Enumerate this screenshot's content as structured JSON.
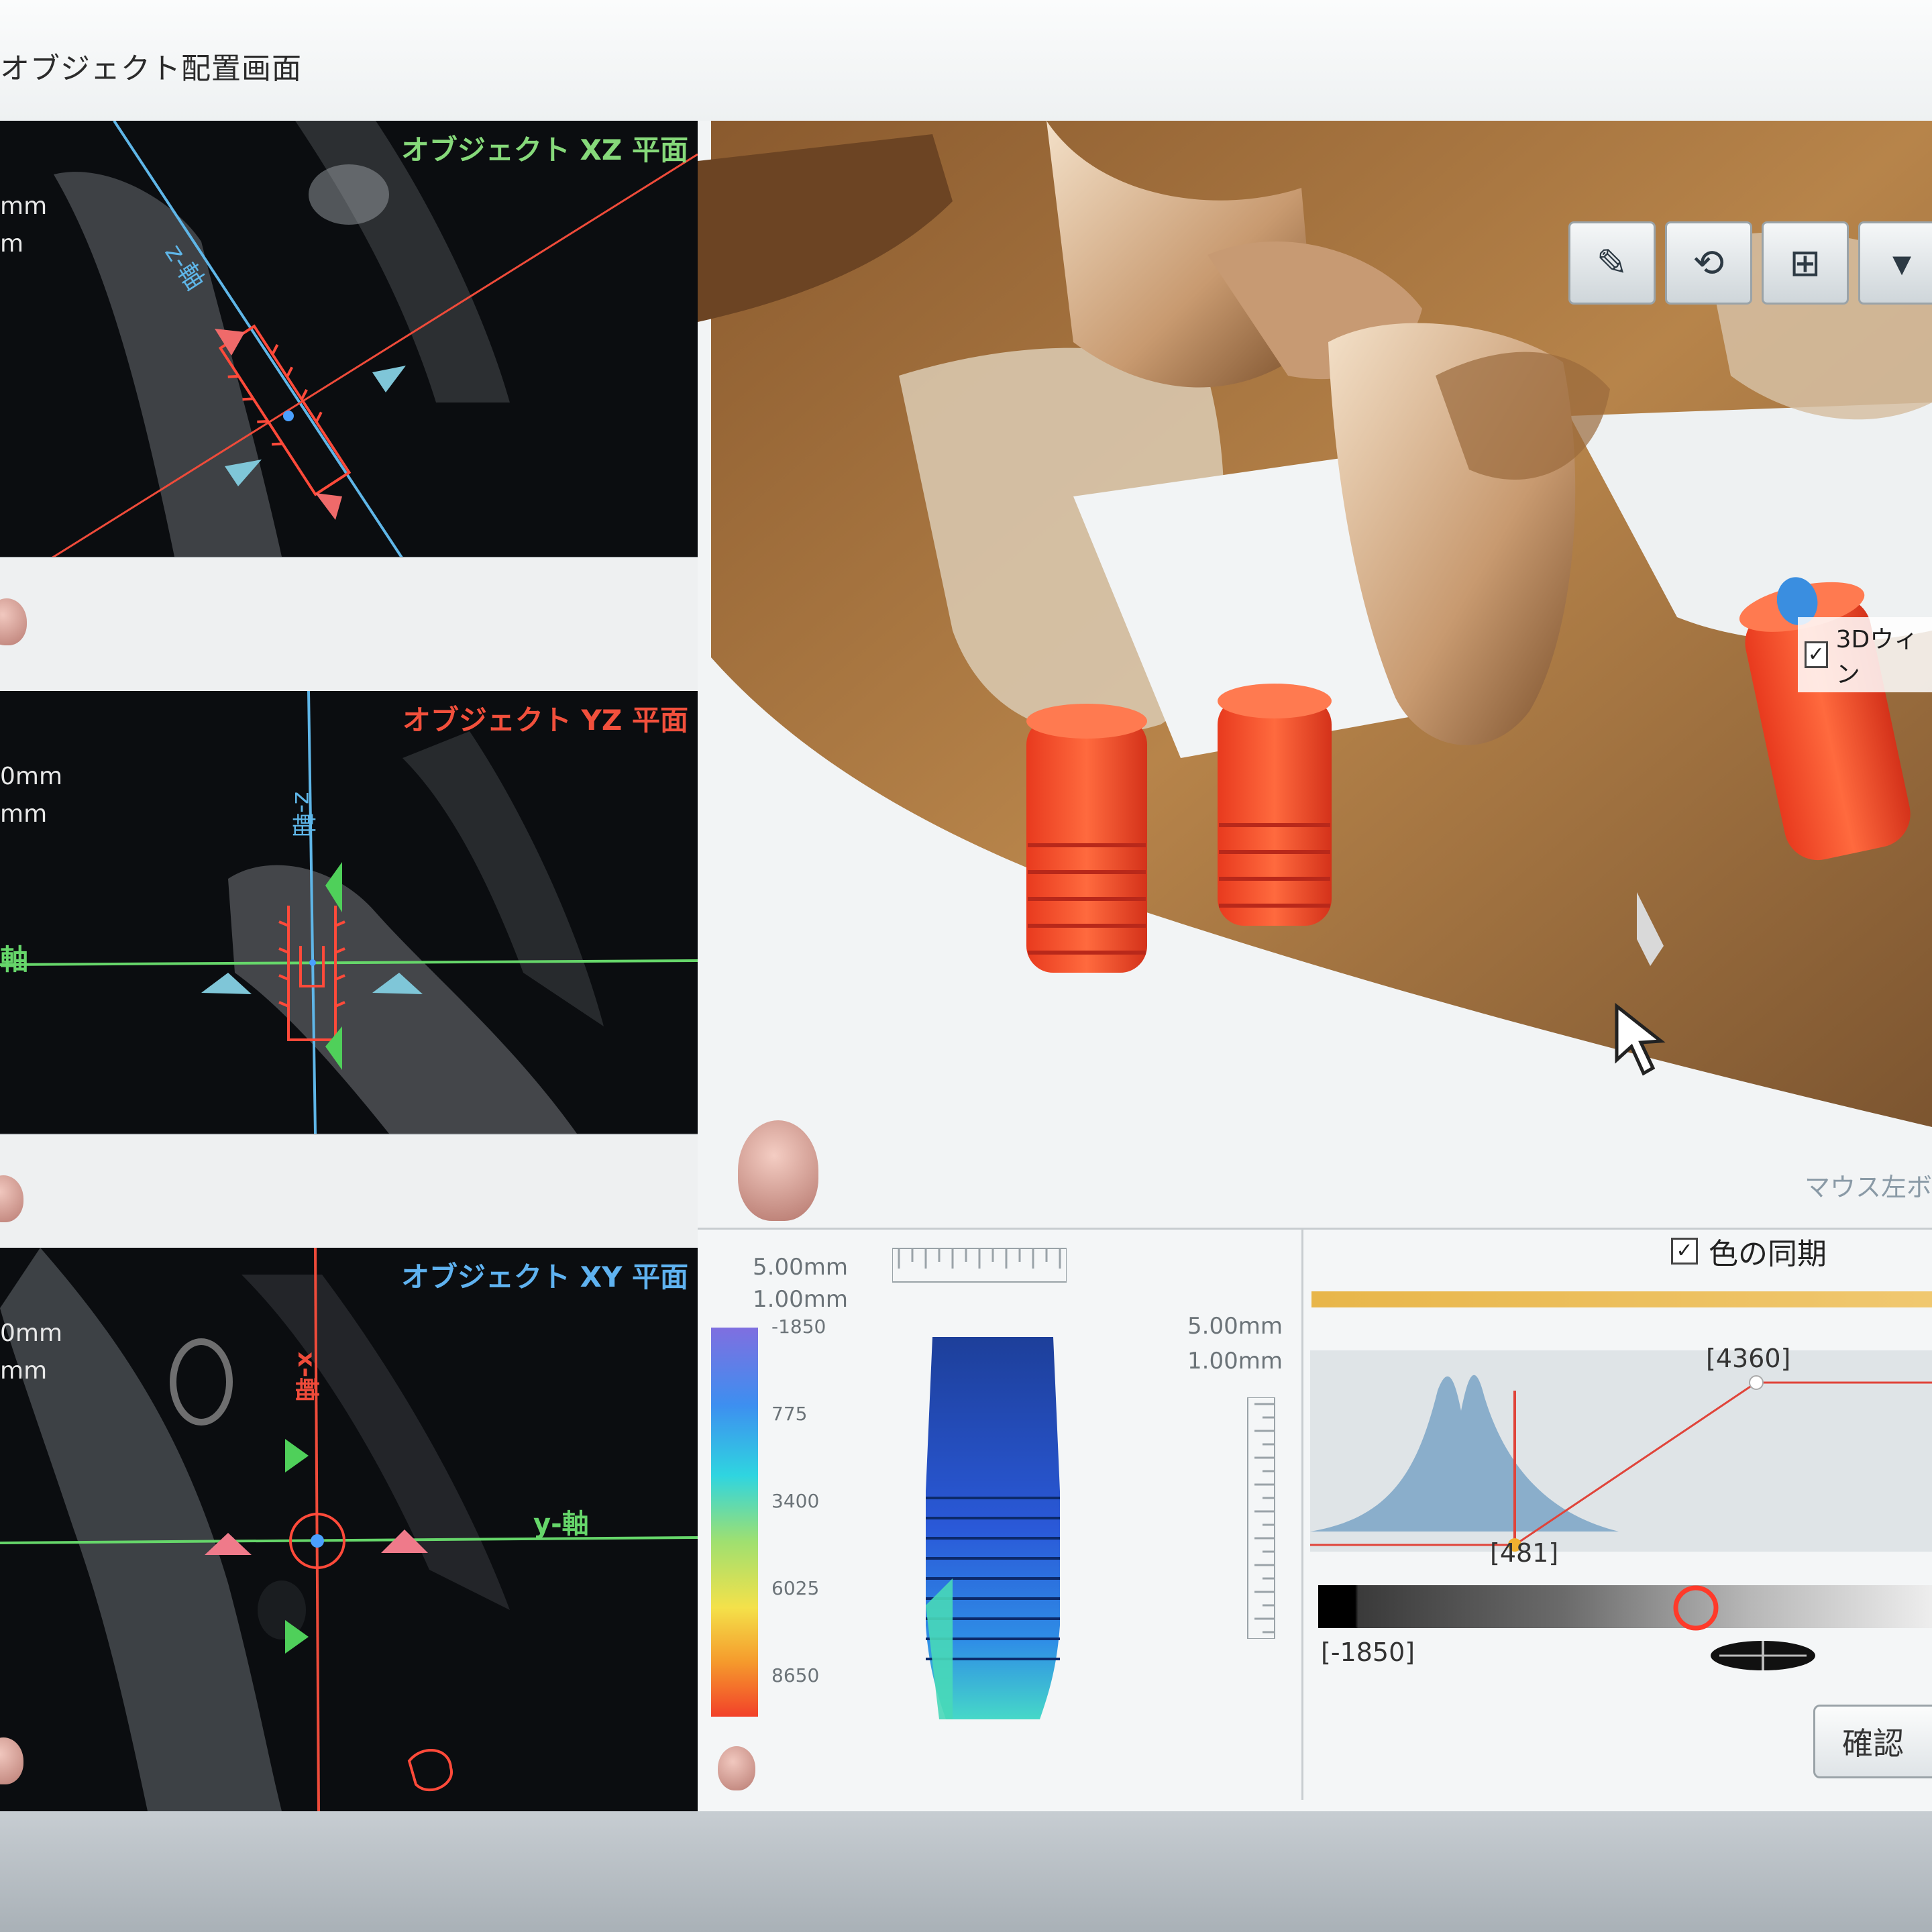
{
  "window": {
    "title": "オブジェクト配置画面"
  },
  "panes": {
    "xz": {
      "label": "オブジェクト XZ 平面",
      "label_color": "#86d97a",
      "mm1": "mm",
      "mm2": "m",
      "axis_label": "z-軸"
    },
    "yz": {
      "label": "オブジェクト YZ 平面",
      "label_color": "#f2503c",
      "mm1": "0mm",
      "mm2": "mm",
      "axis_z": "z-軸",
      "axis_y": "軸"
    },
    "xy": {
      "label": "オブジェクト XY 平面",
      "label_color": "#5fb2f0",
      "mm1": "0mm",
      "mm2": "mm",
      "axis_x": "x-軸",
      "axis_y": "y-軸"
    }
  },
  "view3d": {
    "toolbar_icons": [
      "pen-tool-icon",
      "rotate-axes-icon",
      "cross-section-icon",
      "more-icon"
    ],
    "window_check_label": "3Dウィン",
    "window_check_checked": true,
    "mouse_hint": "マウス左ボ"
  },
  "legend": {
    "size1": "5.00mm",
    "size2": "1.00mm",
    "ticks": [
      "-1850",
      "775",
      "3400",
      "6025",
      "8650"
    ],
    "size3": "5.00mm",
    "size4": "1.00mm"
  },
  "transfer": {
    "sync_label": "色の同期",
    "sync_checked": true,
    "max_label": "[4360]",
    "mid_label": "[481]",
    "min_label": "[-1850]",
    "confirm_label": "確認"
  }
}
